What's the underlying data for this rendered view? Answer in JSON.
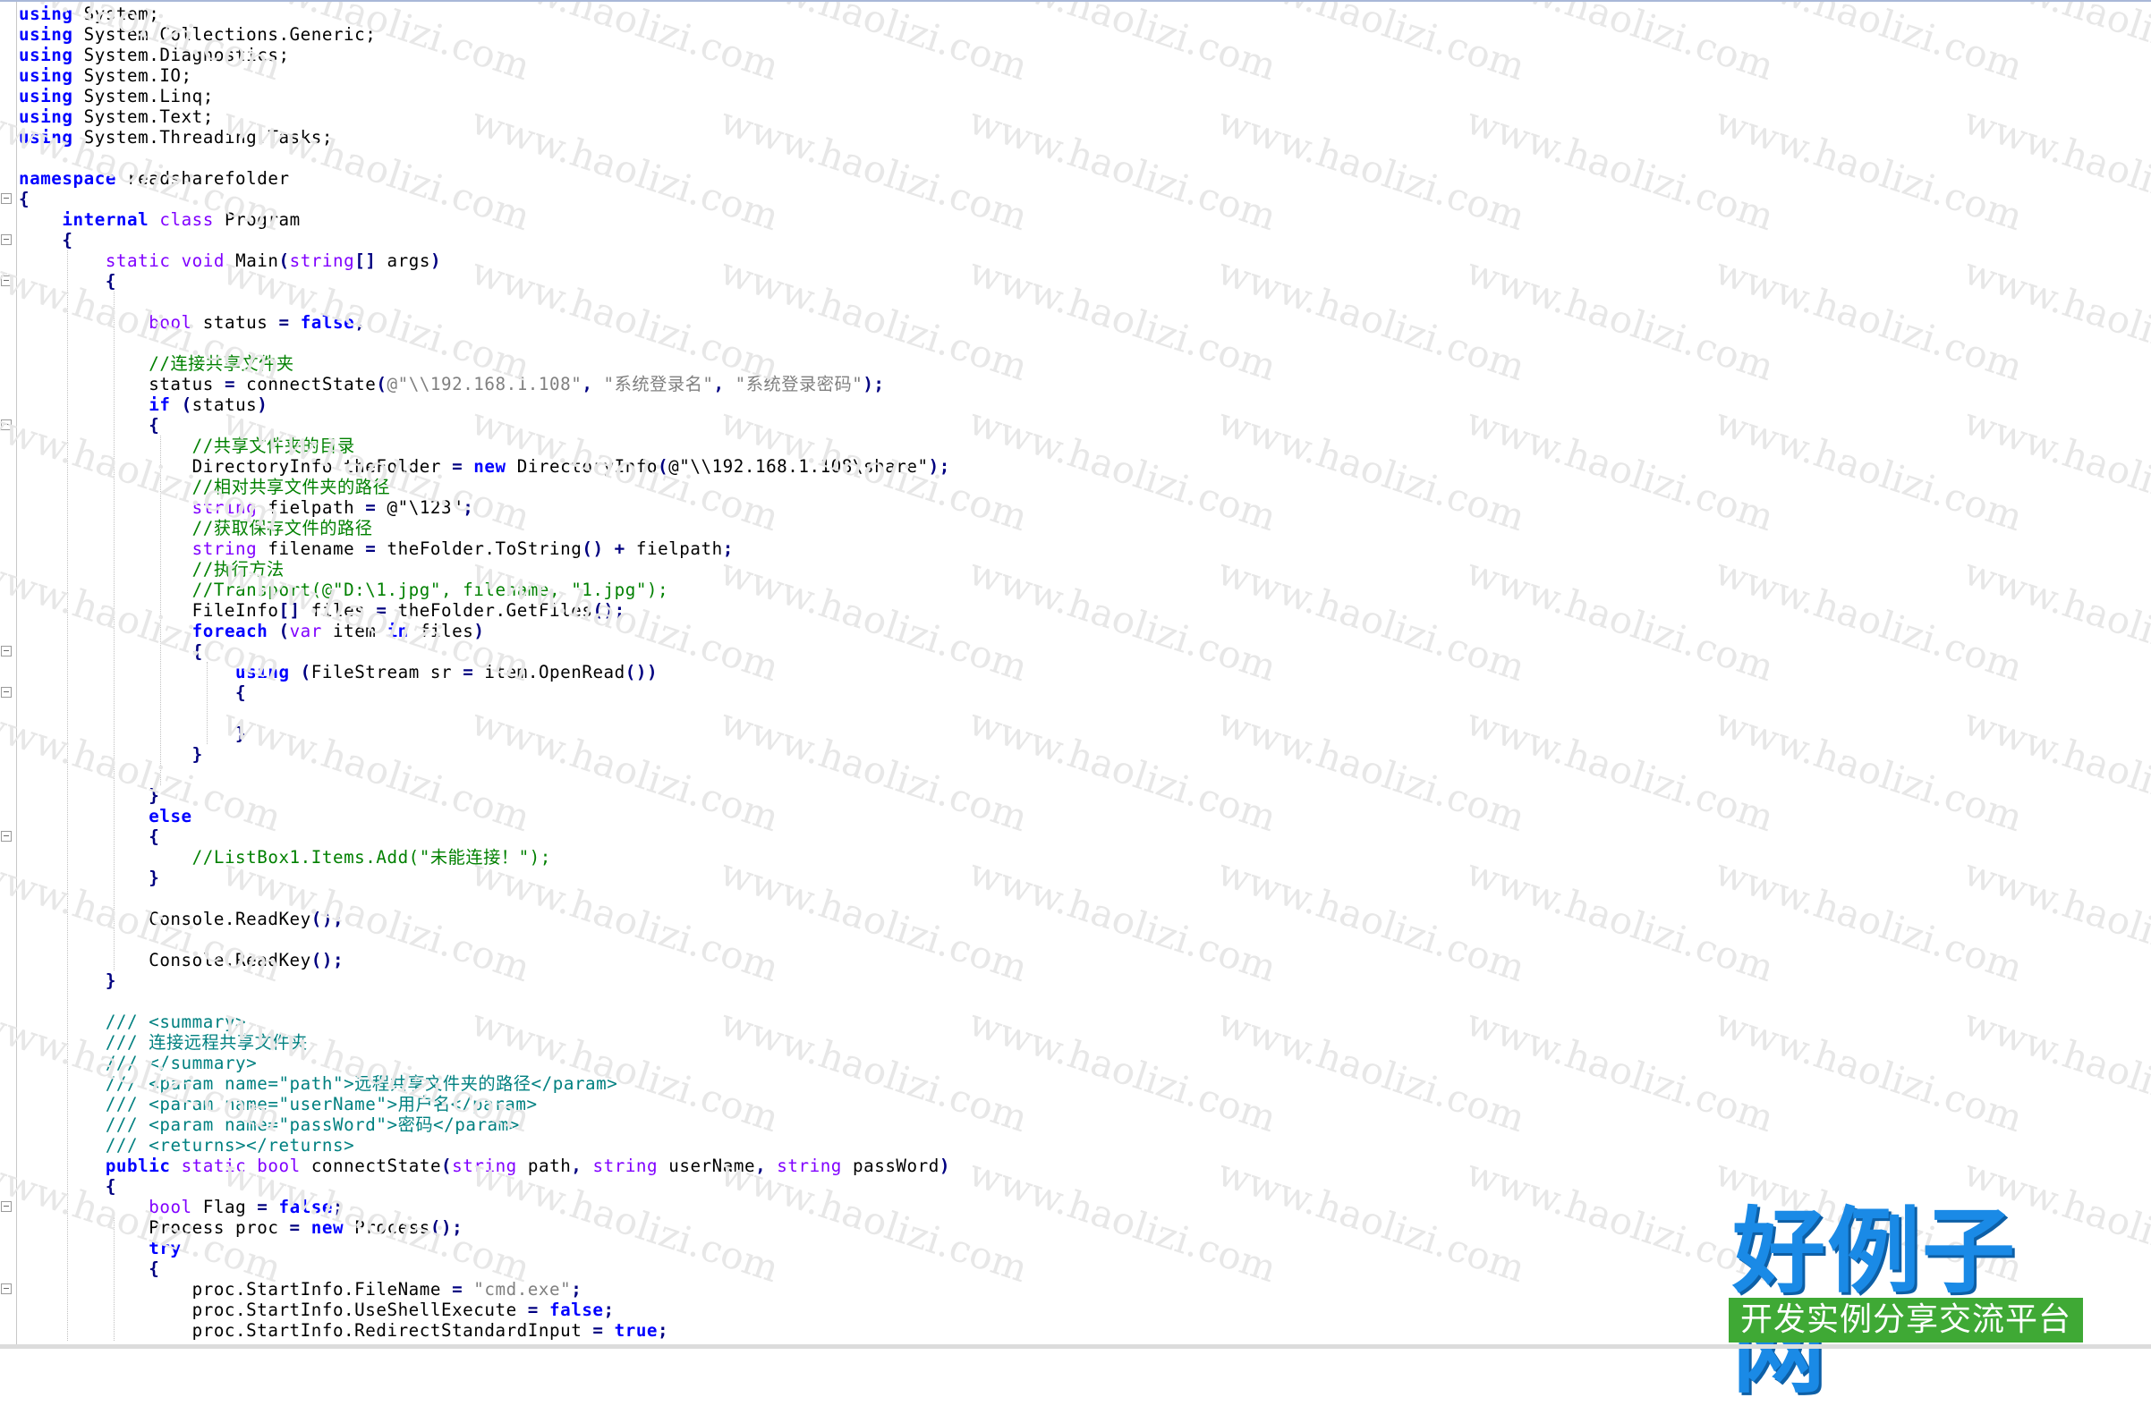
{
  "watermark": {
    "text": "www.haolizi.com"
  },
  "logo": {
    "title": "好例子网",
    "subtitle": "开发实例分享交流平台"
  },
  "lines": [
    [
      [
        "k",
        "using"
      ],
      [
        "p",
        " System;"
      ]
    ],
    [
      [
        "k",
        "using"
      ],
      [
        "p",
        " System.Collections.Generic;"
      ]
    ],
    [
      [
        "k",
        "using"
      ],
      [
        "p",
        " System.Diagnostics;"
      ]
    ],
    [
      [
        "k",
        "using"
      ],
      [
        "p",
        " System.IO;"
      ]
    ],
    [
      [
        "k",
        "using"
      ],
      [
        "p",
        " System.Linq;"
      ]
    ],
    [
      [
        "k",
        "using"
      ],
      [
        "p",
        " System.Text;"
      ]
    ],
    [
      [
        "k",
        "using"
      ],
      [
        "p",
        " System.Threading.Tasks;"
      ]
    ],
    [],
    [
      [
        "k",
        "namespace"
      ],
      [
        "p",
        " readsharefolder"
      ]
    ],
    [
      [
        "o",
        "{"
      ]
    ],
    [
      [
        "p",
        "    "
      ],
      [
        "k",
        "internal"
      ],
      [
        "p",
        " "
      ],
      [
        "kp",
        "class"
      ],
      [
        "p",
        " Program"
      ]
    ],
    [
      [
        "p",
        "    "
      ],
      [
        "o",
        "{"
      ]
    ],
    [
      [
        "p",
        "        "
      ],
      [
        "kp",
        "static"
      ],
      [
        "p",
        " "
      ],
      [
        "kp",
        "void"
      ],
      [
        "p",
        " Main"
      ],
      [
        "o",
        "("
      ],
      [
        "kp",
        "string"
      ],
      [
        "o",
        "[]"
      ],
      [
        "p",
        " args"
      ],
      [
        "o",
        ")"
      ]
    ],
    [
      [
        "p",
        "        "
      ],
      [
        "o",
        "{"
      ]
    ],
    [],
    [
      [
        "p",
        "            "
      ],
      [
        "kp",
        "bool"
      ],
      [
        "p",
        " status "
      ],
      [
        "o",
        "="
      ],
      [
        "p",
        " "
      ],
      [
        "k",
        "false"
      ],
      [
        "o",
        ";"
      ]
    ],
    [],
    [
      [
        "p",
        "            "
      ],
      [
        "c",
        "//连接共享文件夹"
      ]
    ],
    [
      [
        "p",
        "            status "
      ],
      [
        "o",
        "="
      ],
      [
        "p",
        " connectState"
      ],
      [
        "o",
        "("
      ],
      [
        "s",
        "@\"\\\\192.168.1.108\""
      ],
      [
        "o",
        ","
      ],
      [
        "p",
        " "
      ],
      [
        "s",
        "\"系统登录名\""
      ],
      [
        "o",
        ","
      ],
      [
        "p",
        " "
      ],
      [
        "s",
        "\"系统登录密码\""
      ],
      [
        "o",
        ");"
      ]
    ],
    [
      [
        "p",
        "            "
      ],
      [
        "k",
        "if"
      ],
      [
        "p",
        " "
      ],
      [
        "o",
        "("
      ],
      [
        "p",
        "status"
      ],
      [
        "o",
        ")"
      ]
    ],
    [
      [
        "p",
        "            "
      ],
      [
        "o",
        "{"
      ]
    ],
    [
      [
        "p",
        "                "
      ],
      [
        "c",
        "//共享文件夹的目录"
      ]
    ],
    [
      [
        "p",
        "                DirectoryInfo theFolder "
      ],
      [
        "o",
        "="
      ],
      [
        "p",
        " "
      ],
      [
        "k",
        "new"
      ],
      [
        "p",
        " DirectoryInfo"
      ],
      [
        "o",
        "("
      ],
      [
        "p",
        "@\"\\\\192.168.1.108\\share\""
      ],
      [
        "o",
        ");"
      ]
    ],
    [
      [
        "p",
        "                "
      ],
      [
        "c",
        "//相对共享文件夹的路径"
      ]
    ],
    [
      [
        "p",
        "                "
      ],
      [
        "kp",
        "string"
      ],
      [
        "p",
        " fielpath "
      ],
      [
        "o",
        "="
      ],
      [
        "p",
        " @\"\\123\""
      ],
      [
        "o",
        ";"
      ]
    ],
    [
      [
        "p",
        "                "
      ],
      [
        "c",
        "//获取保存文件的路径"
      ]
    ],
    [
      [
        "p",
        "                "
      ],
      [
        "kp",
        "string"
      ],
      [
        "p",
        " filename "
      ],
      [
        "o",
        "="
      ],
      [
        "p",
        " theFolder.ToString"
      ],
      [
        "o",
        "()"
      ],
      [
        "p",
        " "
      ],
      [
        "o",
        "+"
      ],
      [
        "p",
        " fielpath"
      ],
      [
        "o",
        ";"
      ]
    ],
    [
      [
        "p",
        "                "
      ],
      [
        "c",
        "//执行方法"
      ]
    ],
    [
      [
        "p",
        "                "
      ],
      [
        "c",
        "//Transport(@\"D:\\1.jpg\", filename, \"1.jpg\");"
      ]
    ],
    [
      [
        "p",
        "                FileInfo"
      ],
      [
        "o",
        "[]"
      ],
      [
        "p",
        " files "
      ],
      [
        "o",
        "="
      ],
      [
        "p",
        " theFolder.GetFiles"
      ],
      [
        "o",
        "();"
      ]
    ],
    [
      [
        "p",
        "                "
      ],
      [
        "k",
        "foreach"
      ],
      [
        "p",
        " "
      ],
      [
        "o",
        "("
      ],
      [
        "kp",
        "var"
      ],
      [
        "p",
        " item "
      ],
      [
        "k",
        "in"
      ],
      [
        "p",
        " files"
      ],
      [
        "o",
        ")"
      ]
    ],
    [
      [
        "p",
        "                "
      ],
      [
        "o",
        "{"
      ]
    ],
    [
      [
        "p",
        "                    "
      ],
      [
        "k",
        "using"
      ],
      [
        "p",
        " "
      ],
      [
        "o",
        "("
      ],
      [
        "p",
        "FileStream sr "
      ],
      [
        "o",
        "="
      ],
      [
        "p",
        " item.OpenRead"
      ],
      [
        "o",
        "())"
      ]
    ],
    [
      [
        "p",
        "                    "
      ],
      [
        "o",
        "{"
      ]
    ],
    [],
    [
      [
        "p",
        "                    "
      ],
      [
        "o",
        "}"
      ]
    ],
    [
      [
        "p",
        "                "
      ],
      [
        "o",
        "}"
      ]
    ],
    [],
    [
      [
        "p",
        "            "
      ],
      [
        "o",
        "}"
      ]
    ],
    [
      [
        "p",
        "            "
      ],
      [
        "k",
        "else"
      ]
    ],
    [
      [
        "p",
        "            "
      ],
      [
        "o",
        "{"
      ]
    ],
    [
      [
        "p",
        "                "
      ],
      [
        "c",
        "//ListBox1.Items.Add(\"未能连接！\");"
      ]
    ],
    [
      [
        "p",
        "            "
      ],
      [
        "o",
        "}"
      ]
    ],
    [],
    [
      [
        "p",
        "            Console.ReadKey"
      ],
      [
        "o",
        "();"
      ]
    ],
    [],
    [
      [
        "p",
        "            Console.ReadKey"
      ],
      [
        "o",
        "();"
      ]
    ],
    [
      [
        "p",
        "        "
      ],
      [
        "o",
        "}"
      ]
    ],
    [],
    [
      [
        "p",
        "        "
      ],
      [
        "d",
        "/// <summary>"
      ]
    ],
    [
      [
        "p",
        "        "
      ],
      [
        "d",
        "/// 连接远程共享文件夹"
      ]
    ],
    [
      [
        "p",
        "        "
      ],
      [
        "d",
        "/// </summary>"
      ]
    ],
    [
      [
        "p",
        "        "
      ],
      [
        "d",
        "/// <param name=\"path\">远程共享文件夹的路径</param>"
      ]
    ],
    [
      [
        "p",
        "        "
      ],
      [
        "d",
        "/// <param name=\"userName\">用户名</param>"
      ]
    ],
    [
      [
        "p",
        "        "
      ],
      [
        "d",
        "/// <param name=\"passWord\">密码</param>"
      ]
    ],
    [
      [
        "p",
        "        "
      ],
      [
        "d",
        "/// <returns></returns>"
      ]
    ],
    [
      [
        "p",
        "        "
      ],
      [
        "k",
        "public"
      ],
      [
        "p",
        " "
      ],
      [
        "kp",
        "static"
      ],
      [
        "p",
        " "
      ],
      [
        "kp",
        "bool"
      ],
      [
        "p",
        " connectState"
      ],
      [
        "o",
        "("
      ],
      [
        "kp",
        "string"
      ],
      [
        "p",
        " path"
      ],
      [
        "o",
        ","
      ],
      [
        "p",
        " "
      ],
      [
        "kp",
        "string"
      ],
      [
        "p",
        " userName"
      ],
      [
        "o",
        ","
      ],
      [
        "p",
        " "
      ],
      [
        "kp",
        "string"
      ],
      [
        "p",
        " passWord"
      ],
      [
        "o",
        ")"
      ]
    ],
    [
      [
        "p",
        "        "
      ],
      [
        "o",
        "{"
      ]
    ],
    [
      [
        "p",
        "            "
      ],
      [
        "kp",
        "bool"
      ],
      [
        "p",
        " Flag "
      ],
      [
        "o",
        "="
      ],
      [
        "p",
        " "
      ],
      [
        "k",
        "false"
      ],
      [
        "o",
        ";"
      ]
    ],
    [
      [
        "p",
        "            Process proc "
      ],
      [
        "o",
        "="
      ],
      [
        "p",
        " "
      ],
      [
        "k",
        "new"
      ],
      [
        "p",
        " Process"
      ],
      [
        "o",
        "();"
      ]
    ],
    [
      [
        "p",
        "            "
      ],
      [
        "k",
        "try"
      ]
    ],
    [
      [
        "p",
        "            "
      ],
      [
        "o",
        "{"
      ]
    ],
    [
      [
        "p",
        "                proc.StartInfo.FileName "
      ],
      [
        "o",
        "="
      ],
      [
        "p",
        " "
      ],
      [
        "s",
        "\"cmd.exe\""
      ],
      [
        "o",
        ";"
      ]
    ],
    [
      [
        "p",
        "                proc.StartInfo.UseShellExecute "
      ],
      [
        "o",
        "="
      ],
      [
        "p",
        " "
      ],
      [
        "k",
        "false"
      ],
      [
        "o",
        ";"
      ]
    ],
    [
      [
        "p",
        "                proc.StartInfo.RedirectStandardInput "
      ],
      [
        "o",
        "="
      ],
      [
        "p",
        " "
      ],
      [
        "k",
        "true"
      ],
      [
        "o",
        ";"
      ]
    ]
  ]
}
